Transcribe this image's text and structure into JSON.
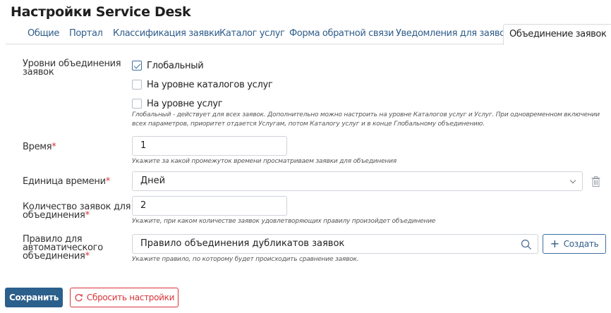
{
  "page": {
    "title": "Настройки Service Desk"
  },
  "tabs": [
    {
      "label": "Общие"
    },
    {
      "label": "Портал"
    },
    {
      "label": "Классификация заявки"
    },
    {
      "label": "Каталог услуг"
    },
    {
      "label": "Форма обратной связи"
    },
    {
      "label": "Уведомления для заявок"
    },
    {
      "label": "Объединение заявок",
      "active": true
    }
  ],
  "levels": {
    "label_line1": "Уровни объединения",
    "label_line2": "заявок",
    "options": [
      {
        "label": "Глобальный",
        "checked": true
      },
      {
        "label": "На уровне каталогов услуг",
        "checked": false
      },
      {
        "label": "На уровне услуг",
        "checked": false
      }
    ],
    "hint_line1": "Глобальный - действует для всех заявок. Дополнительно можно настроить на уровне Каталогов услуг и Услуг. При одновременном включении",
    "hint_line2": "всех параметров, приоритет отдается Услугам, потом Каталогу услуг и в конце Глобальному объединению."
  },
  "time": {
    "label": "Время",
    "required_mark": "*",
    "value": "1",
    "hint": "Укажите за какой промежуток времени просматриваем заявки для объединения"
  },
  "time_unit": {
    "label": "Единица времени",
    "required_mark": "*",
    "value": "Дней"
  },
  "count": {
    "label_line1": "Количество заявок для",
    "label_line2": "объединения",
    "required_mark": "*",
    "value": "2",
    "hint": "Укажите, при каком количестве заявок удовлетворяющих правилу произойдет объединение"
  },
  "rule": {
    "label_line1": "Правило для",
    "label_line2": "автоматического",
    "label_line3": "объединения",
    "required_mark": "*",
    "value": "Правило объединения дубликатов заявок",
    "hint": "Укажите правило, по которому будет происходить сравнение заявок.",
    "create_label": "Создать"
  },
  "actions": {
    "save_label": "Сохранить",
    "reset_label": "Сбросить настройки"
  },
  "colors": {
    "accent": "#2b5f8c",
    "link": "#2f5d8a",
    "danger": "#d8343a"
  }
}
